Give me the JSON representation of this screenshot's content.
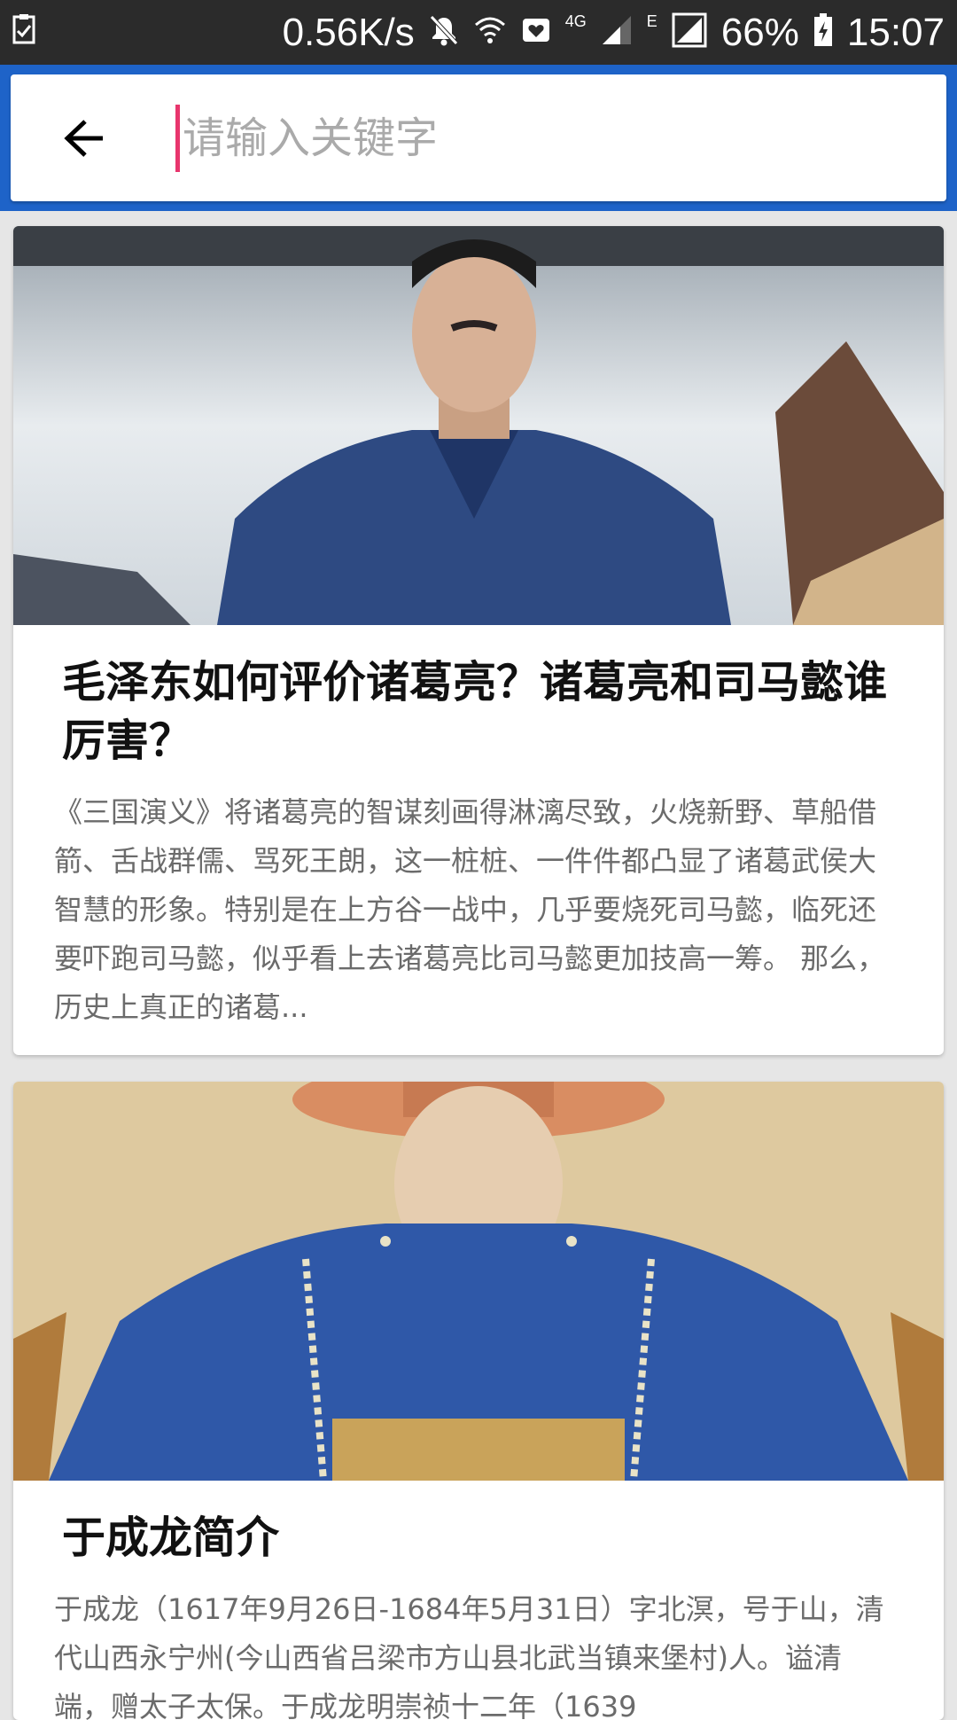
{
  "status_bar": {
    "speed": "0.56K/s",
    "network_4g": "4G",
    "network_e": "E",
    "battery": "66%",
    "time": "15:07",
    "icons": [
      "task-check-icon",
      "mute-icon",
      "wifi-icon",
      "heart-mail-icon",
      "signal-icon",
      "signal-icon",
      "battery-icon"
    ]
  },
  "search": {
    "placeholder": "请输入关键字",
    "value": ""
  },
  "articles": [
    {
      "title": "毛泽东如何评价诸葛亮？诸葛亮和司马懿谁厉害？",
      "summary": "《三国演义》将诸葛亮的智谋刻画得淋漓尽致，火烧新野、草船借箭、舌战群儒、骂死王朗，这一桩桩、一件件都凸显了诸葛武侯大智慧的形象。特别是在上方谷一战中，几乎要烧死司马懿，临死还要吓跑司马懿，似乎看上去诸葛亮比司马懿更加技高一筹。 那么，历史上真正的诸葛..."
    },
    {
      "title": "于成龙简介",
      "summary": "于成龙（1617年9月26日-1684年5月31日）字北溟，号于山，清代山西永宁州(今山西省吕梁市方山县北武当镇来堡村)人。谥清端，赠太子太保。于成龙明崇祯十二年（1639"
    }
  ],
  "colors": {
    "app_bar": "#1e63c8",
    "caret": "#e8356d",
    "status_bar": "#2b2b2b"
  }
}
